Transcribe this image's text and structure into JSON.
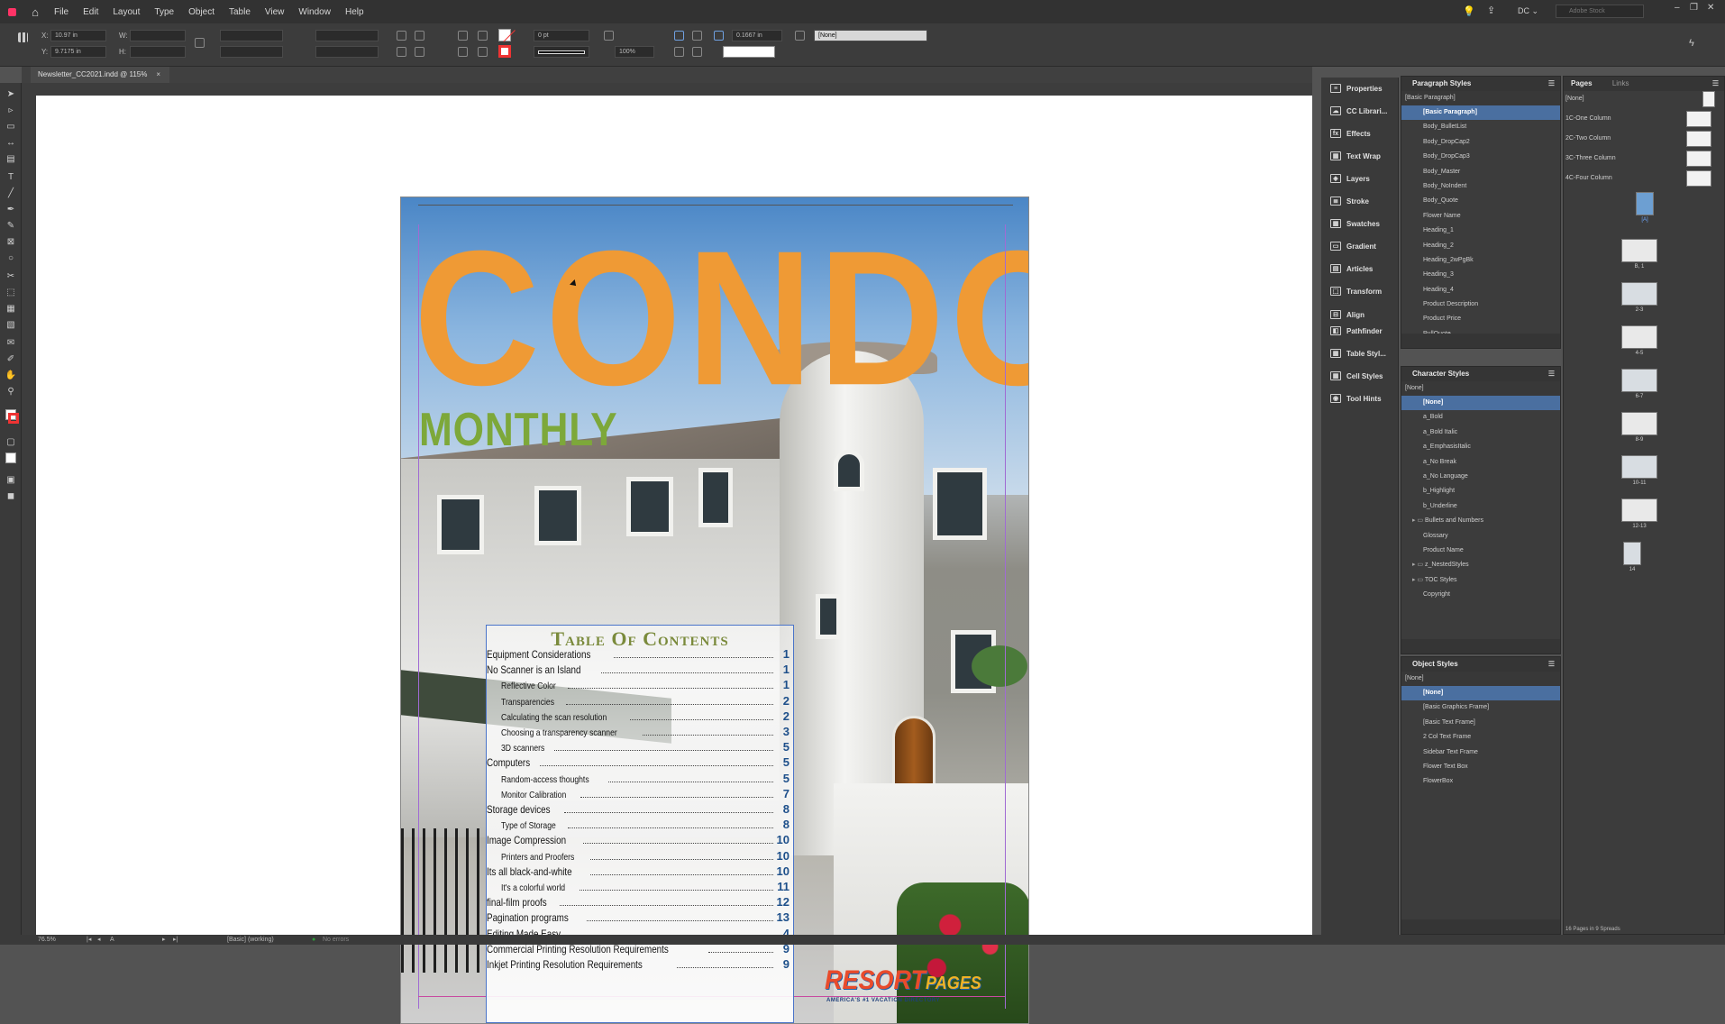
{
  "app": {
    "brand_color": "#ff3366",
    "accent": "#4a6fa0"
  },
  "menu": [
    "File",
    "Edit",
    "Layout",
    "Type",
    "Object",
    "Table",
    "View",
    "Window",
    "Help"
  ],
  "topright": {
    "workspace": "DC",
    "search_placeholder": "Adobe Stock"
  },
  "control": {
    "x_label": "X:",
    "x_value": "10.97 in",
    "y_label": "Y:",
    "y_value": "9.7175 in",
    "w_label": "W:",
    "h_label": "H:",
    "stroke_weight": "0 pt",
    "scale": "100%",
    "offset": "0.1667 in",
    "object_style": "[None]"
  },
  "doc_tab": {
    "title": "Newsletter_CC2021.indd @ 115%",
    "close": "×"
  },
  "cover": {
    "title": "CONDO",
    "subtitle": "MONTHLY",
    "toc_heading": "Table Of Contents",
    "toc": [
      {
        "label": "Equipment Considerations",
        "page": "1",
        "sub": false
      },
      {
        "label": "No Scanner is an Island",
        "page": "1",
        "sub": false
      },
      {
        "label": "Reflective Color",
        "page": "1",
        "sub": true
      },
      {
        "label": "Transparencies",
        "page": "2",
        "sub": true
      },
      {
        "label": "Calculating the scan resolution",
        "page": "2",
        "sub": true
      },
      {
        "label": "Choosing a transparency scanner",
        "page": "3",
        "sub": true
      },
      {
        "label": "3D scanners",
        "page": "5",
        "sub": true
      },
      {
        "label": "Computers",
        "page": "5",
        "sub": false
      },
      {
        "label": "Random-access thoughts",
        "page": "5",
        "sub": true
      },
      {
        "label": "Monitor Calibration",
        "page": "7",
        "sub": true
      },
      {
        "label": "Storage devices",
        "page": "8",
        "sub": false
      },
      {
        "label": "Type of Storage",
        "page": "8",
        "sub": true
      },
      {
        "label": "Image Compression",
        "page": "10",
        "sub": false
      },
      {
        "label": "Printers and Proofers",
        "page": "10",
        "sub": true
      },
      {
        "label": "Its all black-and-white",
        "page": "10",
        "sub": false
      },
      {
        "label": "It's a colorful world",
        "page": "11",
        "sub": true
      },
      {
        "label": "final-film proofs",
        "page": "12",
        "sub": false
      },
      {
        "label": "Pagination programs",
        "page": "13",
        "sub": false
      },
      {
        "label": "Editing Made Easy",
        "page": "4",
        "sub": false
      },
      {
        "label": "Commercial Printing Resolution Requirements",
        "page": "9",
        "sub": false
      },
      {
        "label": "Inkjet Printing Resolution Requirements",
        "page": "9",
        "sub": false
      }
    ],
    "logo_main": "RESORT",
    "logo_second": "PAGES",
    "logo_sub": "AMERICA'S #1 VACATION DIRECTORY"
  },
  "dock": [
    "Properties",
    "CC Librari...",
    "Effects",
    "Text Wrap",
    "Layers",
    "Stroke",
    "Swatches",
    "Gradient",
    "Articles",
    "Transform",
    "Align",
    "Pathfinder",
    "Table Styl...",
    "Cell Styles",
    "Tool Hints"
  ],
  "paragraph_styles": {
    "title": "Paragraph Styles",
    "current": "[Basic Paragraph]",
    "items": [
      "[Basic Paragraph]",
      "Body_BulletList",
      "Body_DropCap2",
      "Body_DropCap3",
      "Body_Master",
      "Body_NoIndent",
      "Body_Quote",
      "Flower Name",
      "Heading_1",
      "Heading_2",
      "Heading_2wPgBk",
      "Heading_3",
      "Heading_4",
      "Product Description",
      "Product Price",
      "PullQuote"
    ]
  },
  "character_styles": {
    "title": "Character Styles",
    "current": "[None]",
    "items": [
      "[None]",
      "a_Bold",
      "a_Bold Italic",
      "a_EmphasisItalic",
      "a_No Break",
      "a_No Language",
      "b_Highlight",
      "b_Underline"
    ],
    "folders": [
      "Bullets and Numbers"
    ],
    "more": [
      "Glossary",
      "Product Name"
    ],
    "folders2": [
      "z_NestedStyles",
      "TOC Styles"
    ],
    "last": [
      "Copyright"
    ]
  },
  "object_styles": {
    "title": "Object Styles",
    "current": "[None]",
    "items": [
      "[None]",
      "[Basic Graphics Frame]",
      "[Basic Text Frame]",
      "2 Col Text Frame",
      "Sidebar Text Frame",
      "Flower Text Box",
      "FlowerBox"
    ]
  },
  "pages_panel": {
    "tabs": [
      "Pages",
      "Links"
    ],
    "masters": [
      "[None]",
      "1C-One Column",
      "2C-Two Column",
      "3C-Three Column",
      "4C-Four Column"
    ],
    "page_labels": [
      "[A]",
      "B, 1",
      "2-3",
      "4-5",
      "6-7",
      "8-9",
      "10-11",
      "12-13",
      "14"
    ],
    "summary": "16 Pages in 9 Spreads"
  },
  "status": {
    "zoom": "76.5%",
    "page": "A",
    "preflight_profile": "[Basic] (working)",
    "errors": "No errors"
  }
}
